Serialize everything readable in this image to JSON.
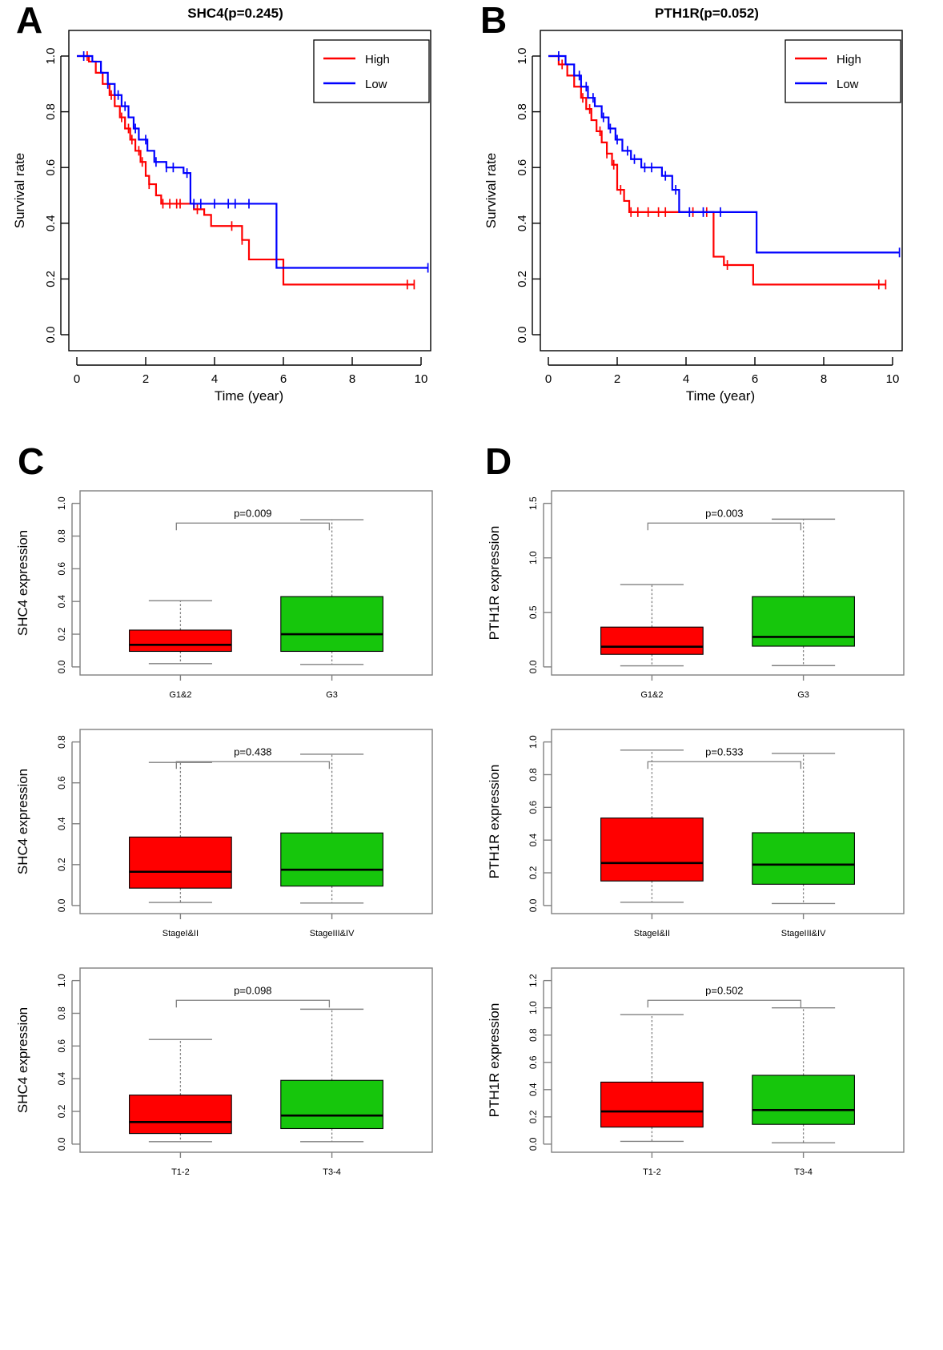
{
  "figure": {
    "panels": [
      "A",
      "B",
      "C",
      "D"
    ]
  },
  "panelA": {
    "letter": "A",
    "title": "SHC4(p=0.245)",
    "xlabel": "Time (year)",
    "ylabel": "Survival rate",
    "legend": [
      "High",
      "Low"
    ],
    "colors": {
      "high": "#FF0000",
      "low": "#0000FF"
    },
    "xticks": [
      "0",
      "2",
      "4",
      "6",
      "8",
      "10"
    ],
    "yticks": [
      "0.0",
      "0.2",
      "0.4",
      "0.6",
      "0.8",
      "1.0"
    ]
  },
  "panelB": {
    "letter": "B",
    "title": "PTH1R(p=0.052)",
    "xlabel": "Time (year)",
    "ylabel": "Survival rate",
    "legend": [
      "High",
      "Low"
    ],
    "colors": {
      "high": "#FF0000",
      "low": "#0000FF"
    },
    "xticks": [
      "0",
      "2",
      "4",
      "6",
      "8",
      "10"
    ],
    "yticks": [
      "0.0",
      "0.2",
      "0.4",
      "0.6",
      "0.8",
      "1.0"
    ]
  },
  "panelC": {
    "letter": "C",
    "ylabel": "SHC4 expression",
    "plots": [
      {
        "pvalue": "p=0.009",
        "yticks": [
          "0.0",
          "0.2",
          "0.4",
          "0.6",
          "0.8",
          "1.0"
        ],
        "groups": [
          "G1&2",
          "G3"
        ]
      },
      {
        "pvalue": "p=0.438",
        "yticks": [
          "0.0",
          "0.2",
          "0.4",
          "0.6",
          "0.8"
        ],
        "groups": [
          "StageI&II",
          "StageIII&IV"
        ]
      },
      {
        "pvalue": "p=0.098",
        "yticks": [
          "0.0",
          "0.2",
          "0.4",
          "0.6",
          "0.8",
          "1.0"
        ],
        "groups": [
          "T1-2",
          "T3-4"
        ]
      }
    ]
  },
  "panelD": {
    "letter": "D",
    "ylabel": "PTH1R expression",
    "plots": [
      {
        "pvalue": "p=0.003",
        "yticks": [
          "0.0",
          "0.5",
          "1.0",
          "1.5"
        ],
        "groups": [
          "G1&2",
          "G3"
        ]
      },
      {
        "pvalue": "p=0.533",
        "yticks": [
          "0.0",
          "0.2",
          "0.4",
          "0.6",
          "0.8",
          "1.0"
        ],
        "groups": [
          "StageI&II",
          "StageIII&IV"
        ]
      },
      {
        "pvalue": "p=0.502",
        "yticks": [
          "0.0",
          "0.2",
          "0.4",
          "0.6",
          "0.8",
          "1.0",
          "1.2"
        ],
        "groups": [
          "T1-2",
          "T3-4"
        ]
      }
    ]
  },
  "chart_data": [
    {
      "id": "A",
      "type": "line",
      "title": "SHC4(p=0.245)",
      "subtitle": "Kaplan-Meier overall survival, SHC4 high vs low expression",
      "xlabel": "Time (year)",
      "ylabel": "Survival rate",
      "xlim": [
        0,
        10.5
      ],
      "ylim": [
        0.0,
        1.0
      ],
      "grid": false,
      "legend_position": "top-right",
      "series": [
        {
          "name": "High",
          "color": "#FF0000",
          "steps": [
            [
              0.0,
              1.0
            ],
            [
              0.35,
              0.98
            ],
            [
              0.55,
              0.94
            ],
            [
              0.75,
              0.9
            ],
            [
              0.95,
              0.86
            ],
            [
              1.1,
              0.82
            ],
            [
              1.25,
              0.78
            ],
            [
              1.4,
              0.74
            ],
            [
              1.55,
              0.7
            ],
            [
              1.7,
              0.66
            ],
            [
              1.85,
              0.62
            ],
            [
              2.0,
              0.57
            ],
            [
              2.1,
              0.54
            ],
            [
              2.3,
              0.5
            ],
            [
              2.45,
              0.47
            ],
            [
              3.4,
              0.45
            ],
            [
              3.7,
              0.43
            ],
            [
              3.9,
              0.39
            ],
            [
              4.8,
              0.34
            ],
            [
              5.0,
              0.27
            ],
            [
              6.0,
              0.18
            ],
            [
              9.8,
              0.18
            ]
          ],
          "censor_times": [
            0.3,
            1.0,
            1.3,
            1.5,
            1.6,
            1.8,
            1.9,
            2.1,
            2.5,
            2.7,
            2.9,
            3.0,
            3.5,
            4.5,
            4.8,
            5.8,
            9.6,
            9.8
          ]
        },
        {
          "name": "Low",
          "color": "#0000FF",
          "steps": [
            [
              0.0,
              1.0
            ],
            [
              0.45,
              0.98
            ],
            [
              0.7,
              0.94
            ],
            [
              0.9,
              0.9
            ],
            [
              1.1,
              0.86
            ],
            [
              1.3,
              0.82
            ],
            [
              1.5,
              0.78
            ],
            [
              1.65,
              0.74
            ],
            [
              1.8,
              0.7
            ],
            [
              2.05,
              0.66
            ],
            [
              2.25,
              0.62
            ],
            [
              2.6,
              0.6
            ],
            [
              3.1,
              0.58
            ],
            [
              3.3,
              0.47
            ],
            [
              5.75,
              0.47
            ],
            [
              5.8,
              0.24
            ],
            [
              10.2,
              0.24
            ]
          ],
          "censor_times": [
            0.2,
            0.9,
            1.2,
            1.4,
            1.7,
            2.0,
            2.3,
            2.6,
            2.8,
            3.2,
            3.4,
            3.6,
            4.0,
            4.4,
            4.6,
            5.0,
            10.2
          ]
        }
      ]
    },
    {
      "id": "B",
      "type": "line",
      "title": "PTH1R(p=0.052)",
      "subtitle": "Kaplan-Meier overall survival, PTH1R high vs low expression",
      "xlabel": "Time (year)",
      "ylabel": "Survival rate",
      "xlim": [
        0,
        10.5
      ],
      "ylim": [
        0.0,
        1.0
      ],
      "grid": false,
      "legend_position": "top-right",
      "series": [
        {
          "name": "High",
          "color": "#FF0000",
          "steps": [
            [
              0.0,
              1.0
            ],
            [
              0.3,
              0.97
            ],
            [
              0.55,
              0.93
            ],
            [
              0.75,
              0.89
            ],
            [
              0.95,
              0.85
            ],
            [
              1.1,
              0.81
            ],
            [
              1.25,
              0.77
            ],
            [
              1.4,
              0.73
            ],
            [
              1.55,
              0.69
            ],
            [
              1.7,
              0.65
            ],
            [
              1.85,
              0.61
            ],
            [
              2.0,
              0.52
            ],
            [
              2.2,
              0.48
            ],
            [
              2.35,
              0.44
            ],
            [
              3.6,
              0.44
            ],
            [
              4.8,
              0.28
            ],
            [
              5.1,
              0.25
            ],
            [
              5.95,
              0.18
            ],
            [
              9.8,
              0.18
            ]
          ],
          "censor_times": [
            0.4,
            1.0,
            1.2,
            1.5,
            1.7,
            1.9,
            2.1,
            2.4,
            2.6,
            2.9,
            3.2,
            3.4,
            4.2,
            4.6,
            5.2,
            9.6,
            9.8
          ]
        },
        {
          "name": "Low",
          "color": "#0000FF",
          "steps": [
            [
              0.0,
              1.0
            ],
            [
              0.5,
              0.97
            ],
            [
              0.75,
              0.93
            ],
            [
              0.95,
              0.89
            ],
            [
              1.15,
              0.85
            ],
            [
              1.35,
              0.82
            ],
            [
              1.55,
              0.78
            ],
            [
              1.75,
              0.74
            ],
            [
              1.95,
              0.7
            ],
            [
              2.15,
              0.66
            ],
            [
              2.4,
              0.63
            ],
            [
              2.7,
              0.6
            ],
            [
              3.3,
              0.57
            ],
            [
              3.6,
              0.52
            ],
            [
              3.8,
              0.44
            ],
            [
              6.0,
              0.44
            ],
            [
              6.05,
              0.295
            ],
            [
              10.2,
              0.295
            ]
          ],
          "censor_times": [
            0.3,
            0.9,
            1.1,
            1.3,
            1.6,
            1.8,
            2.0,
            2.3,
            2.5,
            2.8,
            3.0,
            3.4,
            3.7,
            4.1,
            4.5,
            5.0,
            10.2
          ]
        }
      ]
    },
    {
      "id": "C1",
      "type": "box",
      "title": "SHC4 expression by tumor grade",
      "ylabel": "SHC4 expression",
      "pvalue": 0.009,
      "ylim": [
        0.0,
        1.0
      ],
      "categories": [
        "G1&2",
        "G3"
      ],
      "boxes": [
        {
          "group": "G1&2",
          "color": "#FF0000",
          "lower_whisker": 0.02,
          "q1": 0.095,
          "median": 0.135,
          "q3": 0.225,
          "upper_whisker": 0.405
        },
        {
          "group": "G3",
          "color": "#16C60C",
          "lower_whisker": 0.015,
          "q1": 0.095,
          "median": 0.2,
          "q3": 0.43,
          "upper_whisker": 0.9
        }
      ]
    },
    {
      "id": "C2",
      "type": "box",
      "title": "SHC4 expression by stage",
      "ylabel": "SHC4 expression",
      "pvalue": 0.438,
      "ylim": [
        0.0,
        0.8
      ],
      "categories": [
        "StageI&II",
        "StageIII&IV"
      ],
      "boxes": [
        {
          "group": "StageI&II",
          "color": "#FF0000",
          "lower_whisker": 0.015,
          "q1": 0.085,
          "median": 0.165,
          "q3": 0.335,
          "upper_whisker": 0.7
        },
        {
          "group": "StageIII&IV",
          "color": "#16C60C",
          "lower_whisker": 0.012,
          "q1": 0.095,
          "median": 0.175,
          "q3": 0.355,
          "upper_whisker": 0.74
        }
      ]
    },
    {
      "id": "C3",
      "type": "box",
      "title": "SHC4 expression by T stage",
      "ylabel": "SHC4 expression",
      "pvalue": 0.098,
      "ylim": [
        0.0,
        1.0
      ],
      "categories": [
        "T1-2",
        "T3-4"
      ],
      "boxes": [
        {
          "group": "T1-2",
          "color": "#FF0000",
          "lower_whisker": 0.015,
          "q1": 0.065,
          "median": 0.135,
          "q3": 0.3,
          "upper_whisker": 0.64
        },
        {
          "group": "T3-4",
          "color": "#16C60C",
          "lower_whisker": 0.015,
          "q1": 0.095,
          "median": 0.175,
          "q3": 0.39,
          "upper_whisker": 0.825
        }
      ]
    },
    {
      "id": "D1",
      "type": "box",
      "title": "PTH1R expression by tumor grade",
      "ylabel": "PTH1R expression",
      "pvalue": 0.003,
      "ylim": [
        0.0,
        1.5
      ],
      "categories": [
        "G1&2",
        "G3"
      ],
      "boxes": [
        {
          "group": "G1&2",
          "color": "#FF0000",
          "lower_whisker": 0.01,
          "q1": 0.115,
          "median": 0.185,
          "q3": 0.365,
          "upper_whisker": 0.755
        },
        {
          "group": "G3",
          "color": "#16C60C",
          "lower_whisker": 0.012,
          "q1": 0.19,
          "median": 0.275,
          "q3": 0.645,
          "upper_whisker": 1.355
        }
      ]
    },
    {
      "id": "D2",
      "type": "box",
      "title": "PTH1R expression by stage",
      "ylabel": "PTH1R expression",
      "pvalue": 0.533,
      "ylim": [
        0.0,
        1.0
      ],
      "categories": [
        "StageI&II",
        "StageIII&IV"
      ],
      "boxes": [
        {
          "group": "StageI&II",
          "color": "#FF0000",
          "lower_whisker": 0.02,
          "q1": 0.15,
          "median": 0.26,
          "q3": 0.535,
          "upper_whisker": 0.95
        },
        {
          "group": "StageIII&IV",
          "color": "#16C60C",
          "lower_whisker": 0.012,
          "q1": 0.13,
          "median": 0.25,
          "q3": 0.445,
          "upper_whisker": 0.93
        }
      ]
    },
    {
      "id": "D3",
      "type": "box",
      "title": "PTH1R expression by T stage",
      "ylabel": "PTH1R expression",
      "pvalue": 0.502,
      "ylim": [
        0.0,
        1.2
      ],
      "categories": [
        "T1-2",
        "T3-4"
      ],
      "boxes": [
        {
          "group": "T1-2",
          "color": "#FF0000",
          "lower_whisker": 0.02,
          "q1": 0.125,
          "median": 0.24,
          "q3": 0.455,
          "upper_whisker": 0.95
        },
        {
          "group": "T3-4",
          "color": "#16C60C",
          "lower_whisker": 0.01,
          "q1": 0.145,
          "median": 0.25,
          "q3": 0.505,
          "upper_whisker": 1.0
        }
      ]
    }
  ]
}
